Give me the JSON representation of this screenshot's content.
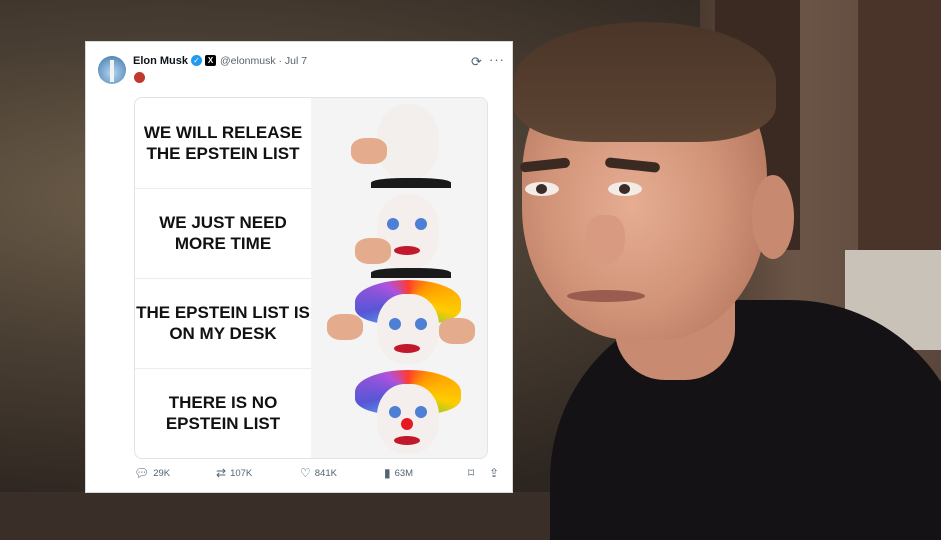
{
  "tweet": {
    "author_name": "Elon Musk",
    "handle_and_date": "@elonmusk · Jul 7",
    "verified_icon": "verified-badge-icon",
    "x_badge": "X",
    "more_label": "···",
    "refresh_icon": "grok-icon"
  },
  "meme": {
    "panels": [
      {
        "text": "WE WILL RELEASE THE EPSTEIN LIST"
      },
      {
        "text": "WE JUST NEED MORE TIME"
      },
      {
        "text": "THE EPSTEIN LIST IS ON MY DESK"
      },
      {
        "text": "THERE IS NO EPSTEIN LIST"
      }
    ]
  },
  "actions": {
    "replies": "29K",
    "reposts": "107K",
    "likes": "841K",
    "views": "63M"
  },
  "colors": {
    "verified": "#1d9bf0",
    "text_secondary": "#536471"
  }
}
